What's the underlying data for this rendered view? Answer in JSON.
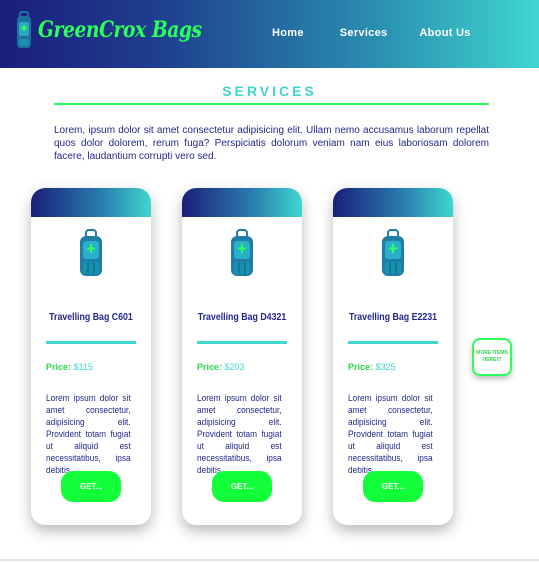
{
  "brand": {
    "name": "GreenCrox Bags"
  },
  "nav": {
    "items": [
      "Home",
      "Services",
      "About Us"
    ]
  },
  "services": {
    "title": "SERVICES",
    "intro": "Lorem, ipsum dolor sit amet consectetur adipisicing elit. Ullam nemo accusamus laborum repellat quos dolor dolorem, rerum fuga? Perspiciatis dolorum veniam nam eius laboriosam dolorem facere, laudantium corrupti vero sed."
  },
  "cards": [
    {
      "name": "Travelling Bag C601",
      "price_label": "Price:",
      "price": "$115",
      "desc": "Lorem ipsum dolor sit amet consectetur, adipisicing elit. Provident totam fugiat ut aliquid est necessitatibus, ipsa debitis.",
      "button": "GET..."
    },
    {
      "name": "Travelling Bag D4321",
      "price_label": "Price:",
      "price": "$203",
      "desc": "Lorem ipsum dolor sit amet consectetur, adipisicing elit. Provident totam fugiat ut aliquid est necessitatibus, ipsa debitis.",
      "button": "GET..."
    },
    {
      "name": "Travelling Bag E2231",
      "price_label": "Price:",
      "price": "$325",
      "desc": "Lorem ipsum dolor sit amet consectetur, adipisicing elit. Provident totam fugiat ut aliquid est necessitatibus, ipsa debitis.",
      "button": "GET..."
    }
  ],
  "more_button": "MORE ITEMS HERE!!!",
  "colors": {
    "accent_green": "#13ff3a",
    "accent_teal": "#3fd6d0",
    "navy": "#1a1f7a"
  },
  "icons": {
    "logo": "backpack-icon",
    "product": "backpack-icon"
  }
}
